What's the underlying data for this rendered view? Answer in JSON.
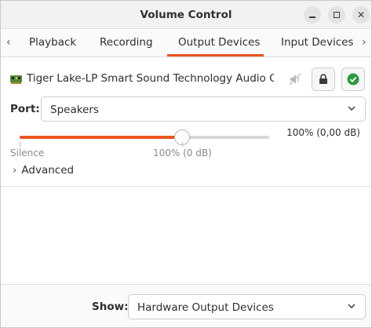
{
  "window": {
    "title": "Volume Control"
  },
  "tabs": [
    {
      "label": "Playback",
      "selected": false
    },
    {
      "label": "Recording",
      "selected": false
    },
    {
      "label": "Output Devices",
      "selected": true
    },
    {
      "label": "Input Devices",
      "selected": false
    }
  ],
  "device": {
    "name": "Tiger Lake-LP Smart Sound Technology Audio C...",
    "port_label": "Port:",
    "port_value": "Speakers",
    "volume_text": "100% (0,00 dB)",
    "volume_level": 0.65,
    "silence_label": "Silence",
    "hundred_label": "100% (0 dB)",
    "advanced_label": "Advanced"
  },
  "footer": {
    "show_label": "Show:",
    "show_value": "Hardware Output Devices"
  },
  "colors": {
    "accent": "#e95420",
    "default_check": "#2e9a3f"
  },
  "icons": {
    "device": "soundcard-icon",
    "mute": "speaker-muted-icon",
    "lock": "lock-icon",
    "default": "check-circle-icon"
  }
}
